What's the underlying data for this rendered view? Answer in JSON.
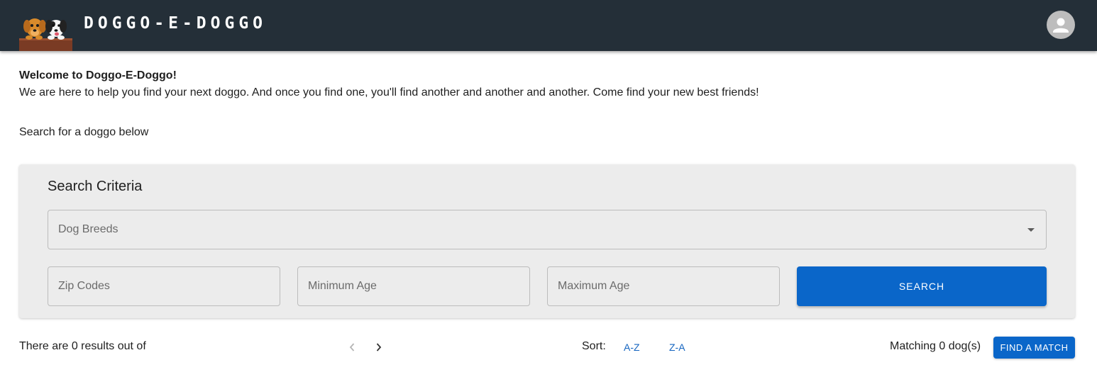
{
  "header": {
    "brand": "DOGGO-E-DOGGO",
    "logo_icon": "two-dogs-logo-icon",
    "avatar_icon": "account-avatar-icon",
    "bar_color": "#242f38"
  },
  "intro": {
    "title": "Welcome to Doggo-E-Doggo!",
    "text": "We are here to help you find your next doggo. And once you find one, you'll find another and another and another. Come find your new best friends!",
    "search_hint": "Search for a doggo below"
  },
  "search": {
    "title": "Search Criteria",
    "breeds_placeholder": "Dog Breeds",
    "zip_placeholder": "Zip Codes",
    "min_age_placeholder": "Minimum Age",
    "max_age_placeholder": "Maximum Age",
    "search_label": "SEARCH",
    "accent_color": "#0a66c9"
  },
  "results_bar": {
    "results_text": "There are 0 results out of",
    "sort_label": "Sort:",
    "sort_az": "A-Z",
    "sort_za": "Z-A",
    "matching_text": "Matching 0 dog(s)",
    "find_match_label": "FIND A MATCH",
    "prev_icon": "chevron-left-icon",
    "next_icon": "chevron-right-icon"
  }
}
